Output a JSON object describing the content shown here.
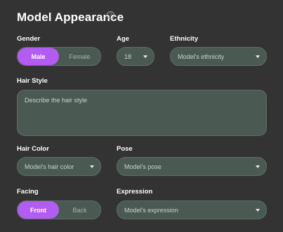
{
  "title": "Model Appearance",
  "info_icon": "info-circle-icon",
  "accent_color": "#b35cf2",
  "gender": {
    "label": "Gender",
    "options": [
      "Male",
      "Female"
    ],
    "selected": "Male"
  },
  "age": {
    "label": "Age",
    "value": "18"
  },
  "ethnicity": {
    "label": "Ethnicity",
    "placeholder": "Model's ethnicity"
  },
  "hair_style": {
    "label": "Hair Style",
    "placeholder": "Describe the hair style"
  },
  "hair_color": {
    "label": "Hair Color",
    "placeholder": "Model's hair color"
  },
  "pose": {
    "label": "Pose",
    "placeholder": "Model's pose"
  },
  "facing": {
    "label": "Facing",
    "options": [
      "Front",
      "Back"
    ],
    "selected": "Front"
  },
  "expression": {
    "label": "Expression",
    "placeholder": "Model's expression"
  }
}
